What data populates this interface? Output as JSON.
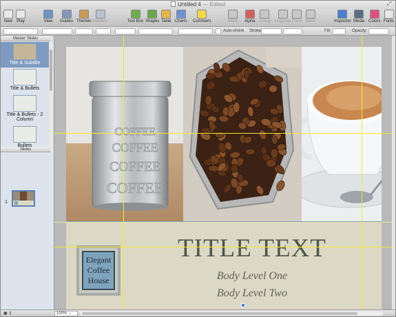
{
  "window": {
    "title": "Untitled 4",
    "status": "— Edited"
  },
  "toolbar": {
    "left": [
      {
        "name": "new",
        "label": "New",
        "color": "#e8e8e8"
      },
      {
        "name": "play",
        "label": "Play",
        "color": "#e8e8e8"
      }
    ],
    "center": [
      {
        "name": "view",
        "label": "View",
        "color": "#6f93c4"
      },
      {
        "name": "guides",
        "label": "Guides",
        "color": "#8098b8"
      },
      {
        "name": "themes",
        "label": "Themes",
        "color": "#c99b55"
      },
      {
        "name": "masters",
        "label": "Masters",
        "color": "#b9c2cf"
      },
      {
        "name": "text-box",
        "label": "Text Box",
        "color": "#6cae4f"
      },
      {
        "name": "shapes",
        "label": "Shapes",
        "color": "#69a74c"
      },
      {
        "name": "table",
        "label": "Table",
        "color": "#e6b548"
      },
      {
        "name": "charts",
        "label": "Charts",
        "color": "#6f93d2"
      },
      {
        "name": "comment",
        "label": "Comment",
        "color": "#f5d944"
      },
      {
        "name": "mask",
        "label": "Mask",
        "color": "#c8c8c8"
      },
      {
        "name": "alpha",
        "label": "Alpha",
        "color": "#d56060"
      },
      {
        "name": "group",
        "label": "Group",
        "color": "#c8c8c8"
      },
      {
        "name": "ungroup",
        "label": "Ungroup",
        "color": "#c8c8c8"
      },
      {
        "name": "front",
        "label": "Front",
        "color": "#c8c8c8"
      },
      {
        "name": "back",
        "label": "Back",
        "color": "#c8c8c8"
      }
    ],
    "right": [
      {
        "name": "inspector",
        "label": "Inspector",
        "color": "#4a7fd4"
      },
      {
        "name": "media",
        "label": "Media",
        "color": "#5a6e84"
      },
      {
        "name": "colors",
        "label": "Colors",
        "color": "#e04f7b"
      },
      {
        "name": "fonts",
        "label": "Fonts",
        "color": "#e8e8e8"
      }
    ]
  },
  "formatbar": {
    "autoshrink": "Auto-shrink",
    "stroke": "Stroke:",
    "fill": "Fill:",
    "opacity": "Opacity:"
  },
  "sidebar": {
    "master_header": "Master Slides",
    "masters": [
      {
        "label": "Title & Subtitle",
        "selected": true
      },
      {
        "label": "Title & Bullets",
        "selected": false
      },
      {
        "label": "Title & Bullets - 2 Column",
        "selected": false
      },
      {
        "label": "Bullets",
        "selected": false
      }
    ],
    "slides_header": "Slides",
    "slide_number": "1"
  },
  "slide": {
    "title": "TITLE TEXT",
    "body_level_one": "Body Level One",
    "body_level_two": "Body Level Two",
    "logo": {
      "line1": "Elegant",
      "line2": "Coffee",
      "line3": "House"
    },
    "canister_text": "COFFEE"
  },
  "statusbar": {
    "zoom": "100%"
  }
}
